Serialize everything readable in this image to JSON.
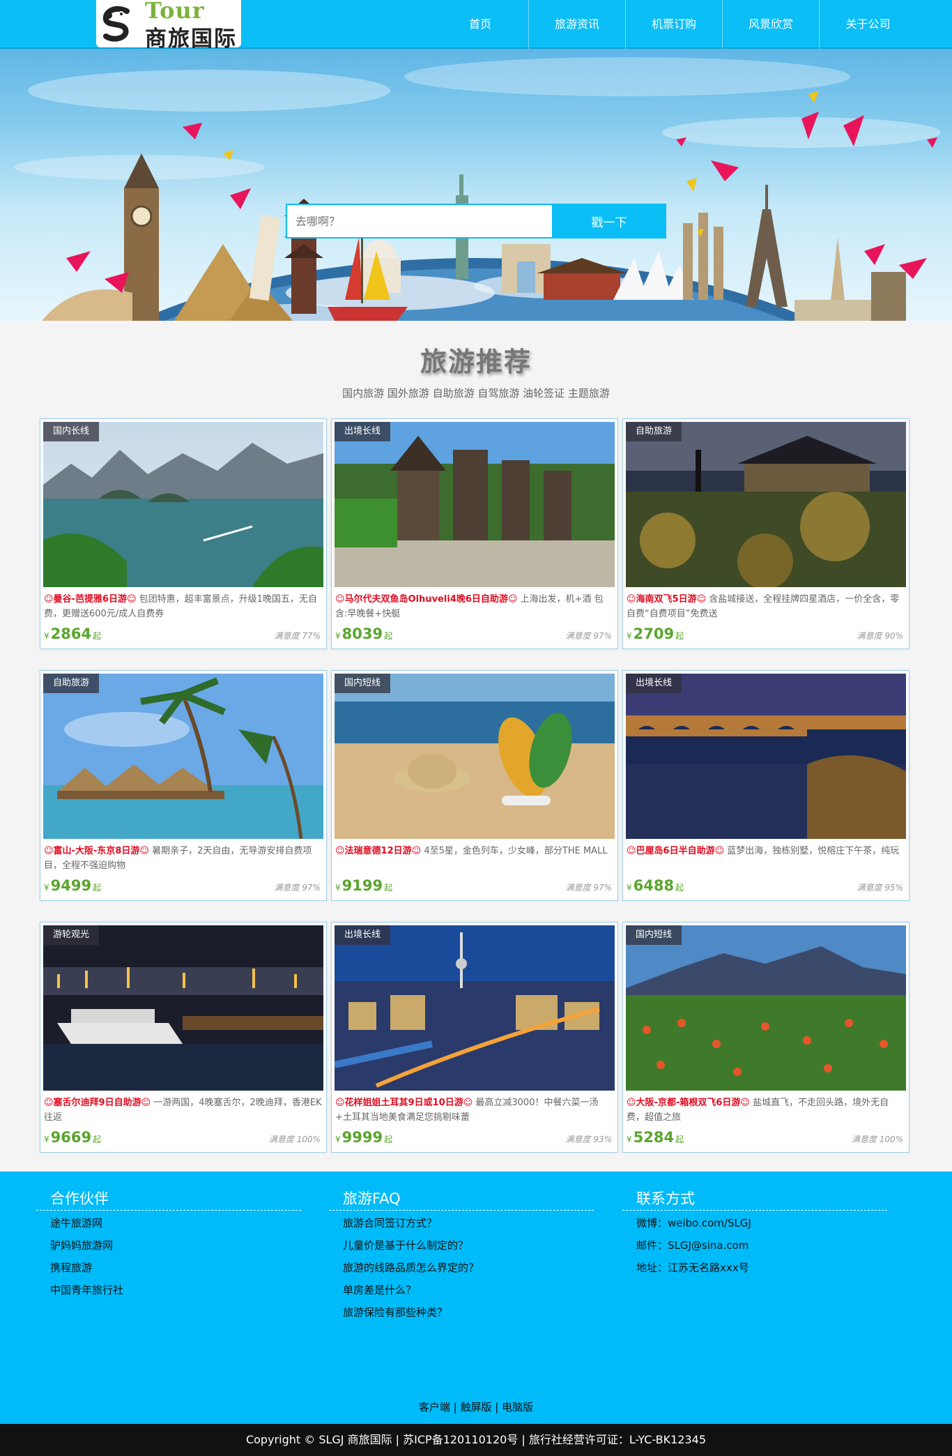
{
  "header": {
    "logo_top": "Tour",
    "logo_bottom": "商旅国际",
    "nav": [
      "首页",
      "旅游资讯",
      "机票订购",
      "风景欣赏",
      "关于公司"
    ]
  },
  "search": {
    "placeholder": "去哪啊？",
    "button": "戳一下"
  },
  "section": {
    "title": "旅游推荐",
    "subtitle": "国内旅游 国外旅游 自助旅游 自驾旅游 油轮签证 主题旅游"
  },
  "cards": [
    {
      "tag": "国内长线",
      "title": "☺曼谷-芭提雅6日游☺",
      "desc": " 包团特惠，超丰富景点，升级1晚国五，无自费，更赠送600元/成人自费券",
      "currency": "¥",
      "price": "2864",
      "unit": "起",
      "satisfaction": "满意度 77%",
      "scene": "bay"
    },
    {
      "tag": "出境长线",
      "title": "☺马尔代夫双鱼岛Olhuveli4晚6日自助游☺",
      "desc": " 上海出发，机+酒 包含:早晚餐+快艇",
      "currency": "¥",
      "price": "8039",
      "unit": "起",
      "satisfaction": "满意度 97%",
      "scene": "temple"
    },
    {
      "tag": "自助旅游",
      "title": "☺海南双飞5日游☺",
      "desc": " 含盐城接送，全程挂牌四星酒店，一价全含，零自费“自费项目”免费送",
      "currency": "¥",
      "price": "2709",
      "unit": "起",
      "satisfaction": "满意度 90%",
      "scene": "night-temple"
    },
    {
      "tag": "自助旅游",
      "title": "☺富山-大阪-东京8日游☺",
      "desc": " 暑期亲子，2天自由，无导游安排自费项目，全程不强迫购物",
      "currency": "¥",
      "price": "9499",
      "unit": "起",
      "satisfaction": "满意度 97%",
      "scene": "palm"
    },
    {
      "tag": "国内短线",
      "title": "☺法瑞意德12日游☺",
      "desc": " 4至5星，金色列车，少女峰，部分THE MALL",
      "currency": "¥",
      "price": "9199",
      "unit": "起",
      "satisfaction": "满意度 97%",
      "scene": "beach"
    },
    {
      "tag": "出境长线",
      "title": "☺巴厘岛6日半自助游☺",
      "desc": " 蓝梦出海，独栋别墅，悦榕庄下午茶，纯玩",
      "currency": "¥",
      "price": "6488",
      "unit": "起",
      "satisfaction": "满意度 95%",
      "scene": "aqueduct"
    },
    {
      "tag": "游轮观光",
      "title": "☺塞舌尔迪拜9日自助游☺",
      "desc": " 一游两国，4晚塞舌尔，2晚迪拜，香港EK往返",
      "currency": "¥",
      "price": "9669",
      "unit": "起",
      "satisfaction": "满意度 100%",
      "scene": "harbor"
    },
    {
      "tag": "出境长线",
      "title": "☺花样姐姐土耳其9日或10日游☺",
      "desc": " 最高立减3000！中餐六菜一汤+土耳其当地美食满足您挑剔味蕾",
      "currency": "¥",
      "price": "9999",
      "unit": "起",
      "satisfaction": "满意度 93%",
      "scene": "city"
    },
    {
      "tag": "国内短线",
      "title": "☺大阪-京都-箱根双飞6日游☺",
      "desc": " 盐城直飞，不走回头路，境外无自费，超值之旅",
      "currency": "¥",
      "price": "5284",
      "unit": "起",
      "satisfaction": "满意度 100%",
      "scene": "flowers"
    }
  ],
  "footer": {
    "partners": {
      "title": "合作伙伴",
      "items": [
        "途牛旅游网",
        "驴妈妈旅游网",
        "携程旅游",
        "中国青年旅行社"
      ]
    },
    "faq": {
      "title": "旅游FAQ",
      "items": [
        "旅游合同签订方式？",
        "儿童价是基于什么制定的？",
        "旅游的线路品质怎么界定的？",
        "单房差是什么？",
        "旅游保险有那些种类？"
      ]
    },
    "contact": {
      "title": "联系方式",
      "items": [
        "微博：weibo.com/SLGJ",
        "邮件：SLGJ@sina.com",
        "地址：江苏无名路xxx号"
      ]
    },
    "links": [
      "客户端",
      "触屏版",
      "电脑版"
    ],
    "copyright": "Copyright © SLGJ 商旅国际 | 苏ICP备120110120号 | 旅行社经营许可证：L-YC-BK12345"
  },
  "colors": {
    "primary": "#0bbef6",
    "price": "#5aa52d",
    "title_red": "#e10b20"
  }
}
